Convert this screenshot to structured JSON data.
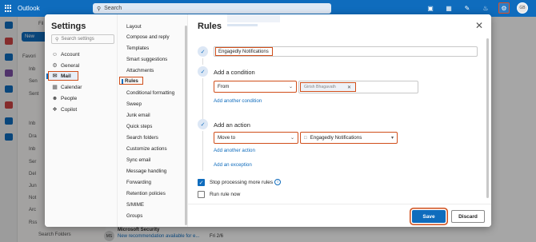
{
  "app": {
    "name": "Outlook"
  },
  "search": {
    "label": "Search"
  },
  "topbar": {
    "avatar_initials": "GB"
  },
  "background": {
    "new_mail": "New",
    "nav_items": [
      "Favori",
      "Inb",
      "Sen",
      "Sent",
      "Inb",
      "Dra",
      "Inb",
      "Ser",
      "Del",
      "Jun",
      "Not",
      "Arc",
      "Rss",
      "Search Folders"
    ],
    "mail_sender": "Microsoft Security",
    "mail_subject": "New recommendation available for e...",
    "mail_date": "Fri 2/6",
    "mail_initials": "MS",
    "mail_folder_prefix": "Fil"
  },
  "settings": {
    "title": "Settings",
    "search_placeholder": "Search settings",
    "categories": [
      {
        "label": "Account",
        "icon": "person-icon"
      },
      {
        "label": "General",
        "icon": "gear-icon"
      },
      {
        "label": "Mail",
        "icon": "mail-icon"
      },
      {
        "label": "Calendar",
        "icon": "calendar-icon"
      },
      {
        "label": "People",
        "icon": "people-icon"
      },
      {
        "label": "Copilot",
        "icon": "copilot-icon"
      }
    ],
    "mail_subsettings": [
      "Layout",
      "Compose and reply",
      "Templates",
      "Smart suggestions",
      "Attachments",
      "Rules",
      "Conditional formatting",
      "Sweep",
      "Junk email",
      "Quick steps",
      "Search folders",
      "Customize actions",
      "Sync email",
      "Message handling",
      "Forwarding",
      "Retention policies",
      "S/MIME",
      "Groups"
    ]
  },
  "rules": {
    "title": "Rules",
    "rule_name": "Engagedly Notifications",
    "condition_heading": "Add a condition",
    "condition_type": "From",
    "condition_value": "Girish Bhagavath",
    "add_another_condition": "Add another condition",
    "action_heading": "Add an action",
    "action_type": "Move to",
    "action_folder": "Engagedly Notifications",
    "add_another_action": "Add another action",
    "add_exception": "Add an exception",
    "stop_processing": "Stop processing more rules",
    "run_rule_now": "Run rule now",
    "stop_processing_checked": true,
    "run_rule_now_checked": false,
    "save": "Save",
    "discard": "Discard"
  },
  "colors": {
    "accent": "#0f6cbd",
    "highlight": "#d04e1a"
  }
}
